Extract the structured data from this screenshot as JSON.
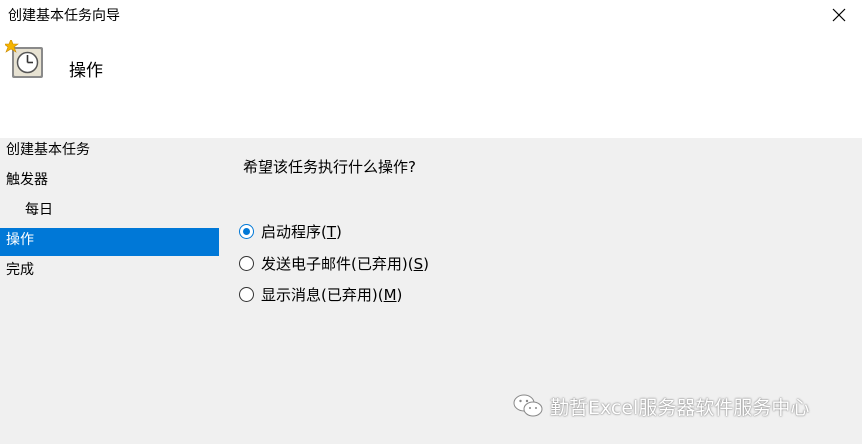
{
  "window": {
    "title": "创建基本任务向导"
  },
  "header": {
    "title": "操作"
  },
  "sidebar": {
    "items": [
      {
        "label": "创建基本任务"
      },
      {
        "label": "触发器"
      },
      {
        "label": "每日"
      },
      {
        "label": "操作"
      },
      {
        "label": "完成"
      }
    ]
  },
  "main": {
    "question": "希望该任务执行什么操作?",
    "options": [
      {
        "label": "启动程序(",
        "key": "T",
        "suffix": ")",
        "checked": true
      },
      {
        "label": "发送电子邮件(已弃用)(",
        "key": "S",
        "suffix": ")",
        "checked": false
      },
      {
        "label": "显示消息(已弃用)(",
        "key": "M",
        "suffix": ")",
        "checked": false
      }
    ]
  },
  "watermark": {
    "text": "勤哲Excel服务器软件服务中心"
  },
  "colors": {
    "accent": "#0078d7",
    "panel": "#f0f0f0"
  },
  "icons": {
    "close": "close-icon",
    "header": "scheduled-task-clock-icon",
    "watermark": "wechat-icon"
  }
}
